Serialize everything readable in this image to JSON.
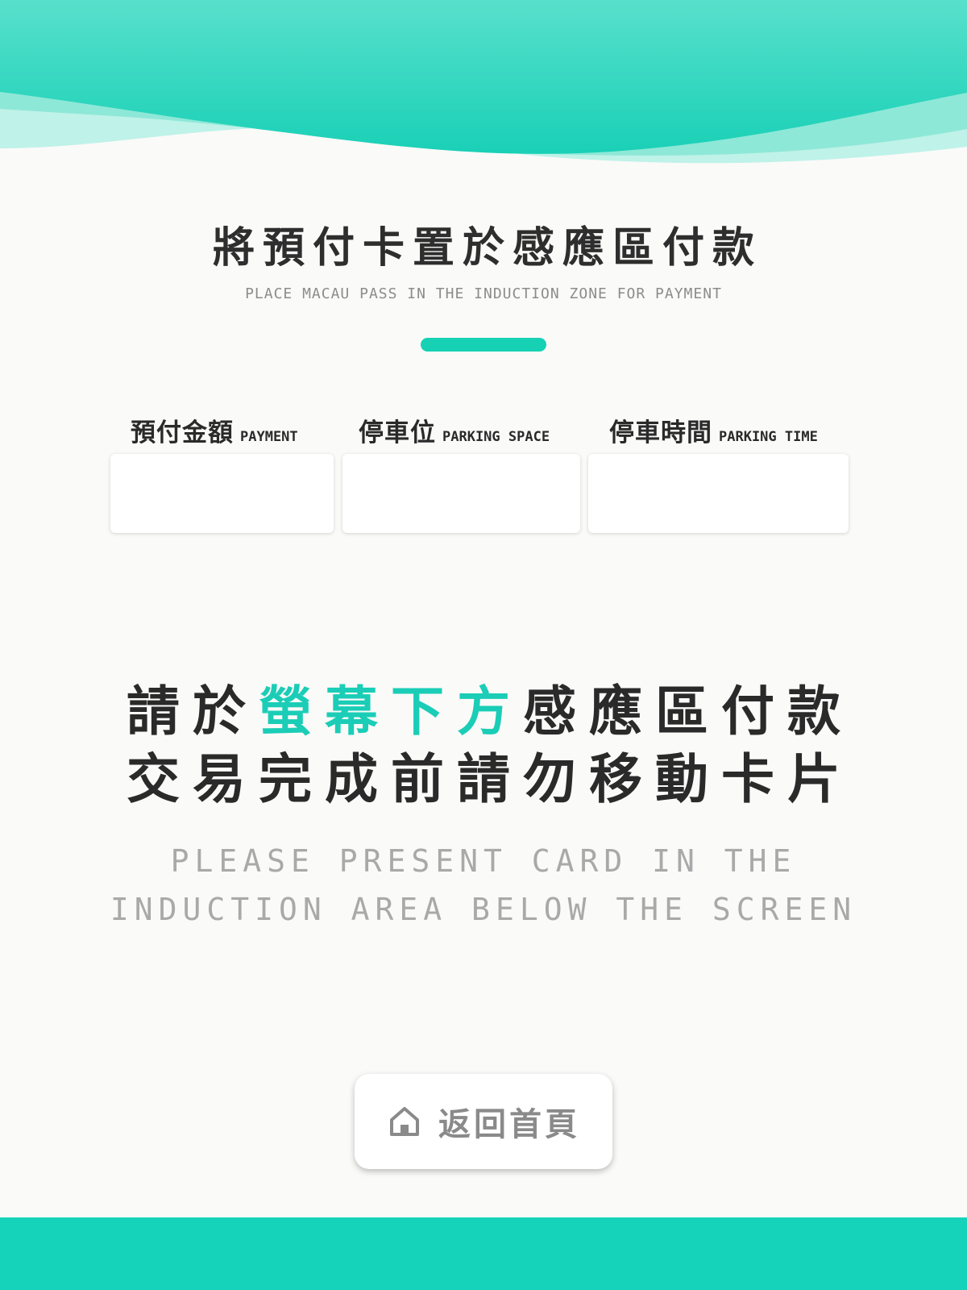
{
  "colors": {
    "accent": "#16d1b4",
    "wave_light": "#a8eddf",
    "bottom_bar": "#15d3bb",
    "background": "#fafaf9"
  },
  "header": {
    "title_zh": "將預付卡置於感應區付款",
    "title_en": "PLACE MACAU PASS IN THE INDUCTION ZONE FOR PAYMENT"
  },
  "info": [
    {
      "label_zh": "預付金額",
      "label_en": "PAYMENT",
      "value": ""
    },
    {
      "label_zh": "停車位",
      "label_en": "PARKING SPACE",
      "value": ""
    },
    {
      "label_zh": "停車時間",
      "label_en": "PARKING TIME",
      "value": ""
    }
  ],
  "instruction": {
    "line1_before": "請於",
    "line1_highlight": "螢幕下方",
    "line1_after": "感應區付款",
    "line2": "交易完成前請勿移動卡片",
    "en_line1": "PLEASE PRESENT CARD IN THE",
    "en_line2": "INDUCTION AREA BELOW THE SCREEN"
  },
  "home_button": {
    "icon": "home-icon",
    "label": "返回首頁"
  }
}
